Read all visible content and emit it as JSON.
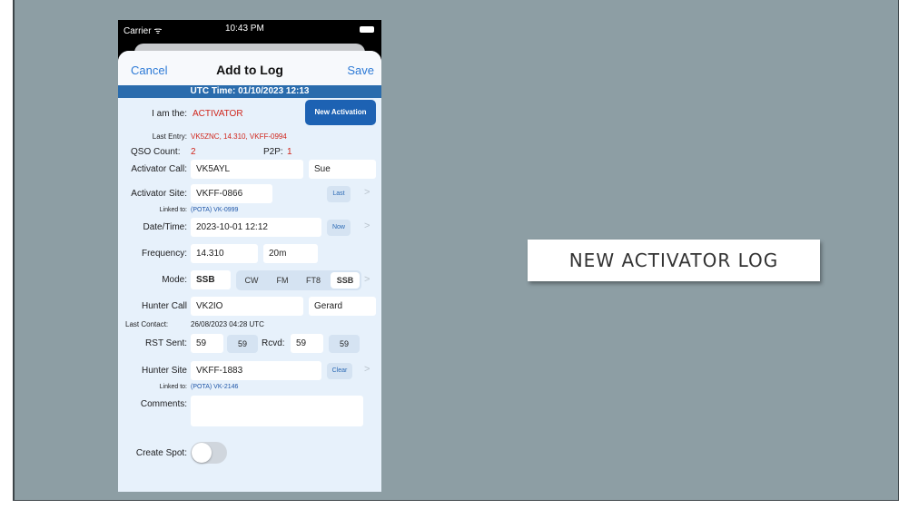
{
  "slide": {
    "banner_text": "NEW ACTIVATOR LOG"
  },
  "status_bar": {
    "carrier": "Carrier ᯤ",
    "time": "10:43 PM"
  },
  "nav": {
    "cancel": "Cancel",
    "title": "Add to Log",
    "save": "Save"
  },
  "utc_time": "UTC Time: 01/10/2023 12:13",
  "role": {
    "label": "I am the:",
    "value": "ACTIVATOR",
    "new_activation": "New Activation"
  },
  "last_entry": {
    "label": "Last Entry:",
    "value": "VK5ZNC, 14.310, VKFF-0994"
  },
  "counts": {
    "qso_label": "QSO Count:",
    "qso_value": "2",
    "p2p_label": "P2P:",
    "p2p_value": "1"
  },
  "activator_call": {
    "label": "Activator Call:",
    "value": "VK5AYL",
    "name": "Sue"
  },
  "activator_site": {
    "label": "Activator Site:",
    "value": "VKFF-0866",
    "last": "Last",
    "linked_label": "Linked to:",
    "linked_value": "(POTA) VK-0999"
  },
  "datetime": {
    "label": "Date/Time:",
    "value": "2023-10-01 12:12",
    "now": "Now"
  },
  "frequency": {
    "label": "Frequency:",
    "value": "14.310",
    "band": "20m"
  },
  "mode": {
    "label": "Mode:",
    "value": "SSB",
    "options": [
      "CW",
      "FM",
      "FT8",
      "SSB"
    ],
    "selected": "SSB"
  },
  "hunter_call": {
    "label": "Hunter Call",
    "value": "VK2IO",
    "name": "Gerard"
  },
  "last_contact": {
    "label": "Last Contact:",
    "value": "26/08/2023 04:28 UTC"
  },
  "rst": {
    "sent_label": "RST Sent:",
    "sent_value": "59",
    "sent_btn": "59",
    "rcvd_label": "Rcvd:",
    "rcvd_value": "59",
    "rcvd_btn": "59"
  },
  "hunter_site": {
    "label": "Hunter Site",
    "value": "VKFF-1883",
    "clear": "Clear",
    "linked_label": "Linked to:",
    "linked_value": "(POTA) VK-2146"
  },
  "comments": {
    "label": "Comments:",
    "value": ""
  },
  "create_spot": {
    "label": "Create Spot:",
    "enabled": false
  }
}
